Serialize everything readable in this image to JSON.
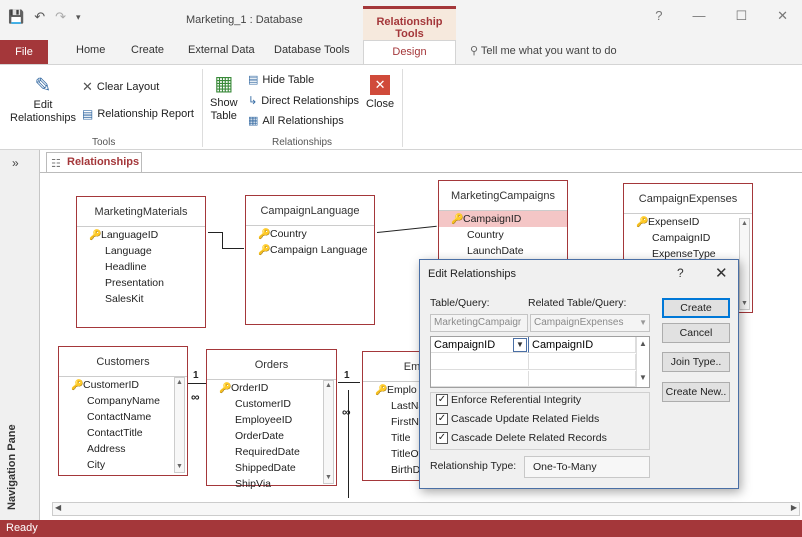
{
  "window": {
    "title": "Marketing_1 : Database",
    "context_tab_group": "Relationship Tools",
    "help_symbol": "?",
    "minimize_symbol": "—",
    "maximize_symbol": "☐",
    "close_symbol": "✕"
  },
  "tabs": {
    "file": "File",
    "home": "Home",
    "create": "Create",
    "external_data": "External Data",
    "database_tools": "Database Tools",
    "design": "Design",
    "tell_me": "Tell me what you want to do"
  },
  "ribbon": {
    "edit_relationships_line1": "Edit",
    "edit_relationships_line2": "Relationships",
    "clear_layout": "Clear Layout",
    "relationship_report": "Relationship Report",
    "tools_group": "Tools",
    "show_table_line1": "Show",
    "show_table_line2": "Table",
    "hide_table": "Hide Table",
    "direct_relationships": "Direct Relationships",
    "all_relationships": "All Relationships",
    "close": "Close",
    "relationships_group": "Relationships"
  },
  "nav": {
    "label": "Navigation Pane",
    "chevron": "»"
  },
  "doc_tab": "Relationships",
  "tables": {
    "marketing_materials": {
      "title": "MarketingMaterials",
      "fields": [
        "LanguageID",
        "Language",
        "Headline",
        "Presentation",
        "SalesKit"
      ]
    },
    "campaign_language": {
      "title": "CampaignLanguage",
      "fields": [
        "Country",
        "Campaign Language"
      ]
    },
    "marketing_campaigns": {
      "title": "MarketingCampaigns",
      "fields": [
        "CampaignID",
        "Country",
        "LaunchDate"
      ]
    },
    "campaign_expenses": {
      "title": "CampaignExpenses",
      "fields": [
        "ExpenseID",
        "CampaignID",
        "ExpenseType"
      ]
    },
    "customers": {
      "title": "Customers",
      "fields": [
        "CustomerID",
        "CompanyName",
        "ContactName",
        "ContactTitle",
        "Address",
        "City"
      ]
    },
    "orders": {
      "title": "Orders",
      "fields": [
        "OrderID",
        "CustomerID",
        "EmployeeID",
        "OrderDate",
        "RequiredDate",
        "ShippedDate",
        "ShipVia"
      ]
    },
    "employees": {
      "title": "Em",
      "fields": [
        "Emplo",
        "LastNa",
        "FirstNa",
        "Title",
        "TitleOf",
        "BirthD"
      ]
    }
  },
  "relations": {
    "one": "1",
    "many": "∞"
  },
  "dialog": {
    "title": "Edit Relationships",
    "help": "?",
    "close": "✕",
    "table_query_label": "Table/Query:",
    "related_label": "Related Table/Query:",
    "table_query_value": "MarketingCampaigr",
    "related_value": "CampaignExpenses",
    "left_field": "CampaignID",
    "right_field": "CampaignID",
    "enforce": "Enforce Referential Integrity",
    "cascade_update": "Cascade Update Related Fields",
    "cascade_delete": "Cascade Delete Related Records",
    "relationship_type_label": "Relationship Type:",
    "relationship_type_value": "One-To-Many",
    "btn_create": "Create",
    "btn_cancel": "Cancel",
    "btn_join_type": "Join Type..",
    "btn_create_new": "Create New.."
  },
  "status": "Ready",
  "colors": {
    "accent": "#a4373a",
    "selected_row": "#f4c6c6",
    "dialog_border": "#4a6fa5"
  }
}
